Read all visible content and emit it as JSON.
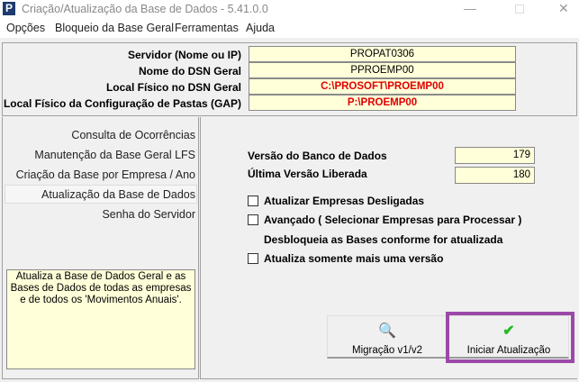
{
  "window": {
    "title": "Criação/Atualização da Base de Dados - 5.41.0.0",
    "logo": "P"
  },
  "menu": [
    "Opções",
    "Bloqueio da Base Geral",
    "Ferramentas",
    "Ajuda"
  ],
  "server": [
    {
      "label": "Servidor (Nome ou IP)",
      "value": "PROPAT0306"
    },
    {
      "label": "Nome do DSN Geral",
      "value": "PPROEMP00"
    },
    {
      "label": "Local Físico no DSN Geral",
      "value": "C:\\PROSOFT\\PROEMP00"
    },
    {
      "label": "Local Físico da Configuração de Pastas (GAP)",
      "value": "P:\\PROEMP00"
    }
  ],
  "nav": [
    "Consulta de Ocorrências",
    "Manutenção da Base Geral LFS",
    "Criação da Base por Empresa / Ano",
    "Atualização da Base de Dados",
    "Senha do Servidor"
  ],
  "description": "Atualiza a Base de Dados Geral e as Bases de Dados de todas as empresas e de todos os 'Movimentos Anuais'.",
  "versions": {
    "db_label": "Versão do Banco de Dados",
    "db_value": "179",
    "last_label": "Última Versão Liberada",
    "last_value": "180"
  },
  "options": {
    "opt1": "Atualizar Empresas Desligadas",
    "opt2": "Avançado ( Selecionar Empresas para Processar )",
    "note": "Desbloqueia as Bases conforme for atualizada",
    "opt3": "Atualiza somente mais uma versão"
  },
  "buttons": {
    "migrate": "Migração v1/v2",
    "start": "Iniciar Atualização"
  },
  "colors": {
    "highlight": "#9b49a8",
    "field": "#ffffd9",
    "check": "#22bb22"
  }
}
